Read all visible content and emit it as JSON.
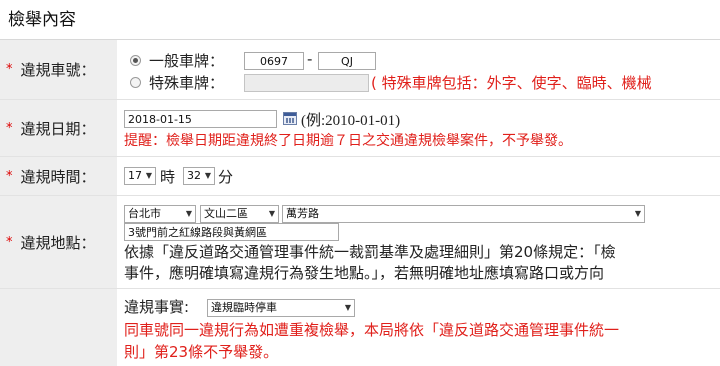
{
  "page": {
    "title": "檢舉內容"
  },
  "plate": {
    "label": "違規車號：",
    "general_label": "一般車牌：",
    "part1": "0697",
    "dash": "-",
    "part2": "QJ",
    "special_label": "特殊車牌：",
    "special_hint": "( 特殊車牌包括：外字、使字、臨時、機械"
  },
  "date": {
    "label": "違規日期：",
    "value": "2018-01-15",
    "example": "(例:2010-01-01)",
    "warning": "提醒：檢舉日期距違規終了日期逾７日之交通違規檢舉案件，不予舉發。"
  },
  "time": {
    "label": "違規時間：",
    "hour": "17",
    "hour_unit": "時",
    "minute": "32",
    "minute_unit": "分"
  },
  "location": {
    "label": "違規地點：",
    "city": "台北市",
    "district": "文山二區",
    "road": "萬芳路",
    "detail": "3號門前之紅線路段與黃網區",
    "note_line1": "依據「違反道路交通管理事件統一裁罰基準及處理細則」第20條規定：「檢",
    "note_line2": "事件，應明確填寫違規行為發生地點。」，若無明確地址應填寫路口或方向"
  },
  "fact": {
    "label": "違規事實:",
    "value": "違規臨時停車",
    "warning_line1": "同車號同一違規行為如遭重複檢舉，本局將依「違反道路交通管理事件統一",
    "warning_line2": "則」第23條不予舉發。"
  },
  "colors": {
    "warning": "#e0201b",
    "label_bg": "#eeeeee"
  }
}
